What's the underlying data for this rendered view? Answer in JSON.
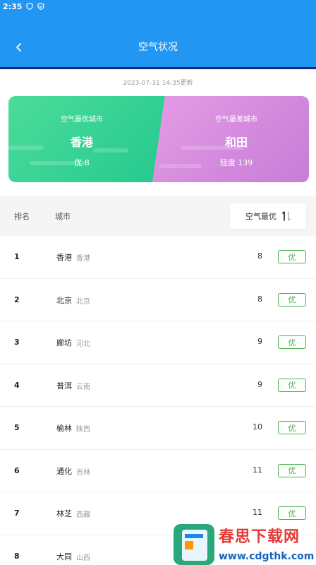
{
  "status_bar": {
    "time": "2:35"
  },
  "header": {
    "title": "空气状况"
  },
  "update_time": "2023-07-31 14:35更新",
  "best": {
    "label": "空气最优城市",
    "city": "香港",
    "value": "优 8"
  },
  "worst": {
    "label": "空气最差城市",
    "city": "和田",
    "value": "轻度 139"
  },
  "table": {
    "col_rank": "排名",
    "col_city": "城市",
    "sort_label": "空气最优",
    "rows": [
      {
        "rank": "1",
        "city": "香港",
        "province": "香港",
        "aqi": "8",
        "level": "优"
      },
      {
        "rank": "2",
        "city": "北京",
        "province": "北京",
        "aqi": "8",
        "level": "优"
      },
      {
        "rank": "3",
        "city": "廊坊",
        "province": "河北",
        "aqi": "9",
        "level": "优"
      },
      {
        "rank": "4",
        "city": "普洱",
        "province": "云南",
        "aqi": "9",
        "level": "优"
      },
      {
        "rank": "5",
        "city": "榆林",
        "province": "陕西",
        "aqi": "10",
        "level": "优"
      },
      {
        "rank": "6",
        "city": "通化",
        "province": "吉林",
        "aqi": "11",
        "level": "优"
      },
      {
        "rank": "7",
        "city": "林芝",
        "province": "西藏",
        "aqi": "11",
        "level": "优"
      },
      {
        "rank": "8",
        "city": "大同",
        "province": "山西",
        "aqi": "",
        "level": ""
      }
    ]
  },
  "watermark": {
    "title": "春思下载网",
    "url": "www.cdgthk.com"
  },
  "colors": {
    "primary": "#2196f3",
    "best": "#2fd29a",
    "worst": "#c57dd8",
    "level_good": "#4caf50"
  }
}
